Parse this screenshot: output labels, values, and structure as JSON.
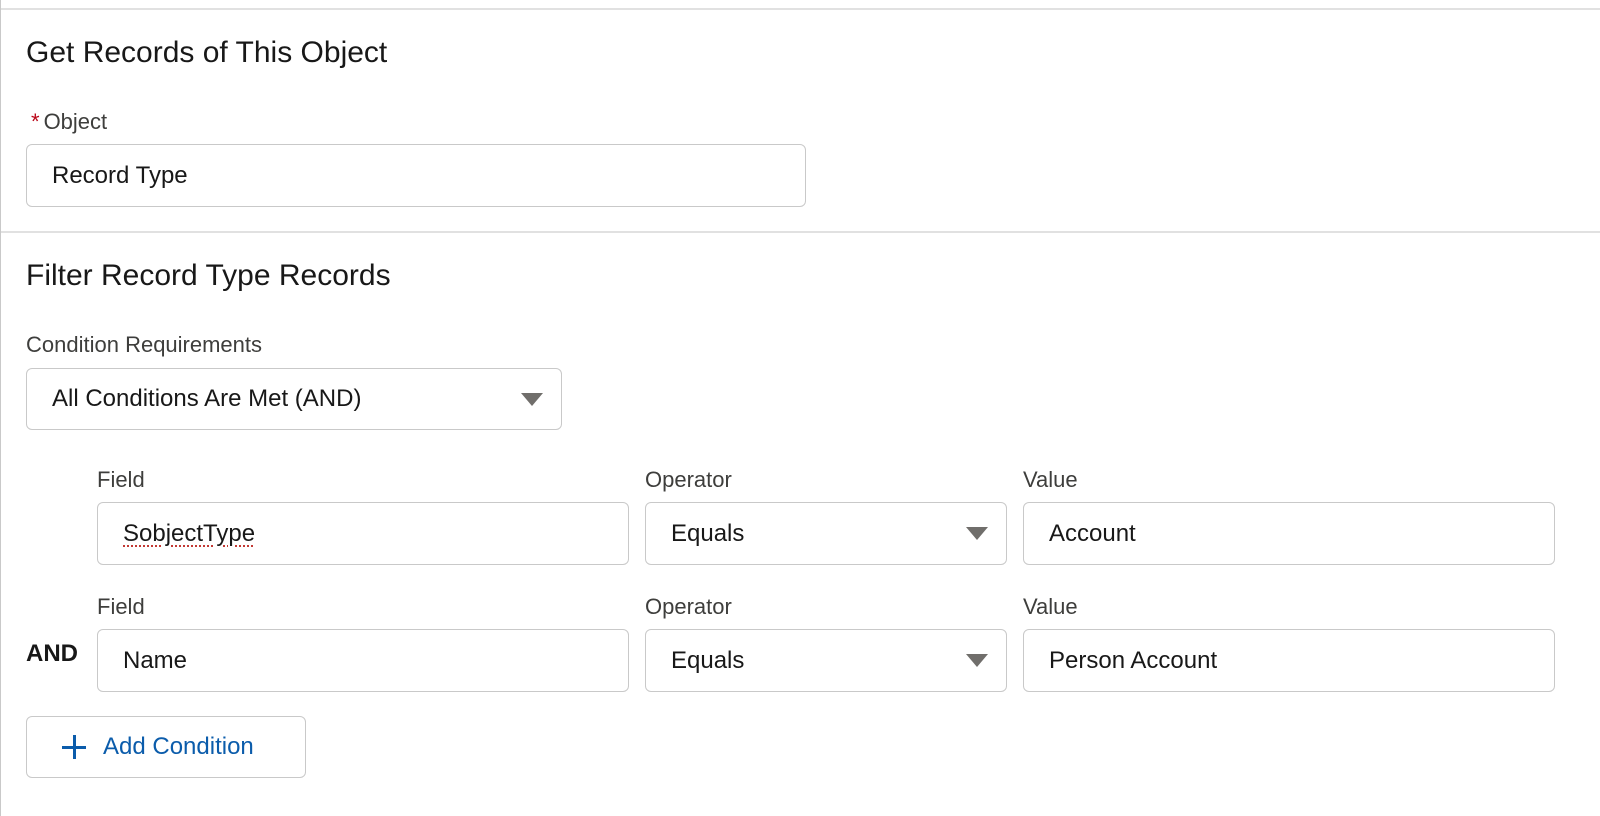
{
  "get_records": {
    "title": "Get Records of This Object",
    "object_label": "Object",
    "required_marker": "*",
    "object_value": "Record Type"
  },
  "filter": {
    "title": "Filter Record Type Records",
    "requirements_label": "Condition Requirements",
    "requirements_value": "All Conditions Are Met (AND)",
    "conditions": [
      {
        "field_label": "Field",
        "field_value": "SobjectType",
        "operator_label": "Operator",
        "operator_value": "Equals",
        "value_label": "Value",
        "value_value": "Account"
      },
      {
        "field_label": "Field",
        "field_value": "Name",
        "operator_label": "Operator",
        "operator_value": "Equals",
        "value_label": "Value",
        "value_value": "Person Account"
      }
    ],
    "logic_label": "AND",
    "add_condition_label": "Add Condition"
  },
  "colors": {
    "accent": "#0b5cab",
    "required": "#ba0517",
    "border": "#c9c9c9"
  }
}
